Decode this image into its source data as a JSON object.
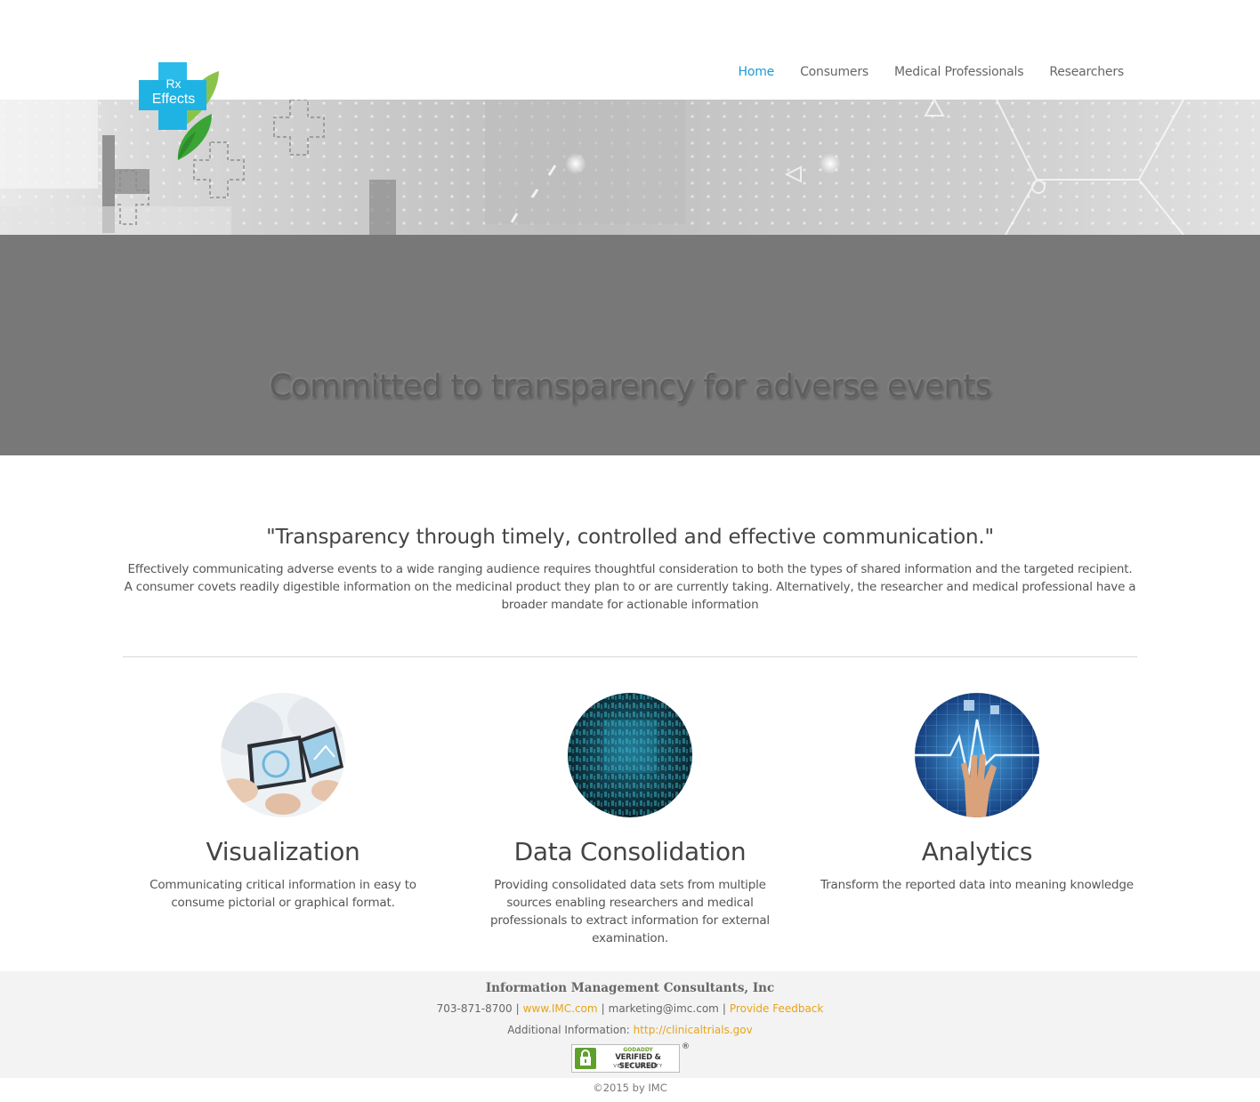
{
  "logo": {
    "line1": "Rx",
    "line2": "Effects"
  },
  "nav": {
    "items": [
      {
        "label": "Home",
        "active": true
      },
      {
        "label": "Consumers",
        "active": false
      },
      {
        "label": "Medical Professionals",
        "active": false
      },
      {
        "label": "Researchers",
        "active": false
      }
    ]
  },
  "hero": {
    "title": "Committed to transparency for adverse events"
  },
  "intro": {
    "quote": "\"Transparency through timely, controlled and effective communication.\"",
    "body": "Effectively communicating adverse events to a wide ranging audience requires thoughtful consideration to both the types of shared information and the targeted recipient. A consumer covets readily digestible information on the medicinal product they plan to or are currently taking. Alternatively, the researcher and medical professional have a broader mandate for actionable information"
  },
  "features": [
    {
      "title": "Visualization",
      "text": "Communicating critical information in easy to consume pictorial or graphical format."
    },
    {
      "title": "Data Consolidation",
      "text": "Providing consolidated data sets from multiple sources enabling researchers and medical professionals to extract information for external examination."
    },
    {
      "title": "Analytics",
      "text": "Transform the reported data into meaning knowledge"
    }
  ],
  "footer": {
    "company": "Information Management Consultants, Inc",
    "phone": "703-871-8700",
    "website": "www.IMC.com",
    "email": "marketing@imc.com",
    "feedback": "Provide Feedback",
    "additional_label": "Additional Information:",
    "additional_link": "http://clinicaltrials.gov",
    "seal_top": "GODADDY",
    "seal_mid": "VERIFIED & SECURED",
    "seal_bot": "VERIFY SECURITY",
    "copyright": "©2015 by IMC"
  },
  "colors": {
    "accent": "#1a9ad6",
    "link": "#e8a317",
    "hero_bg": "#787878",
    "footer_bg": "#f3f3f3"
  }
}
